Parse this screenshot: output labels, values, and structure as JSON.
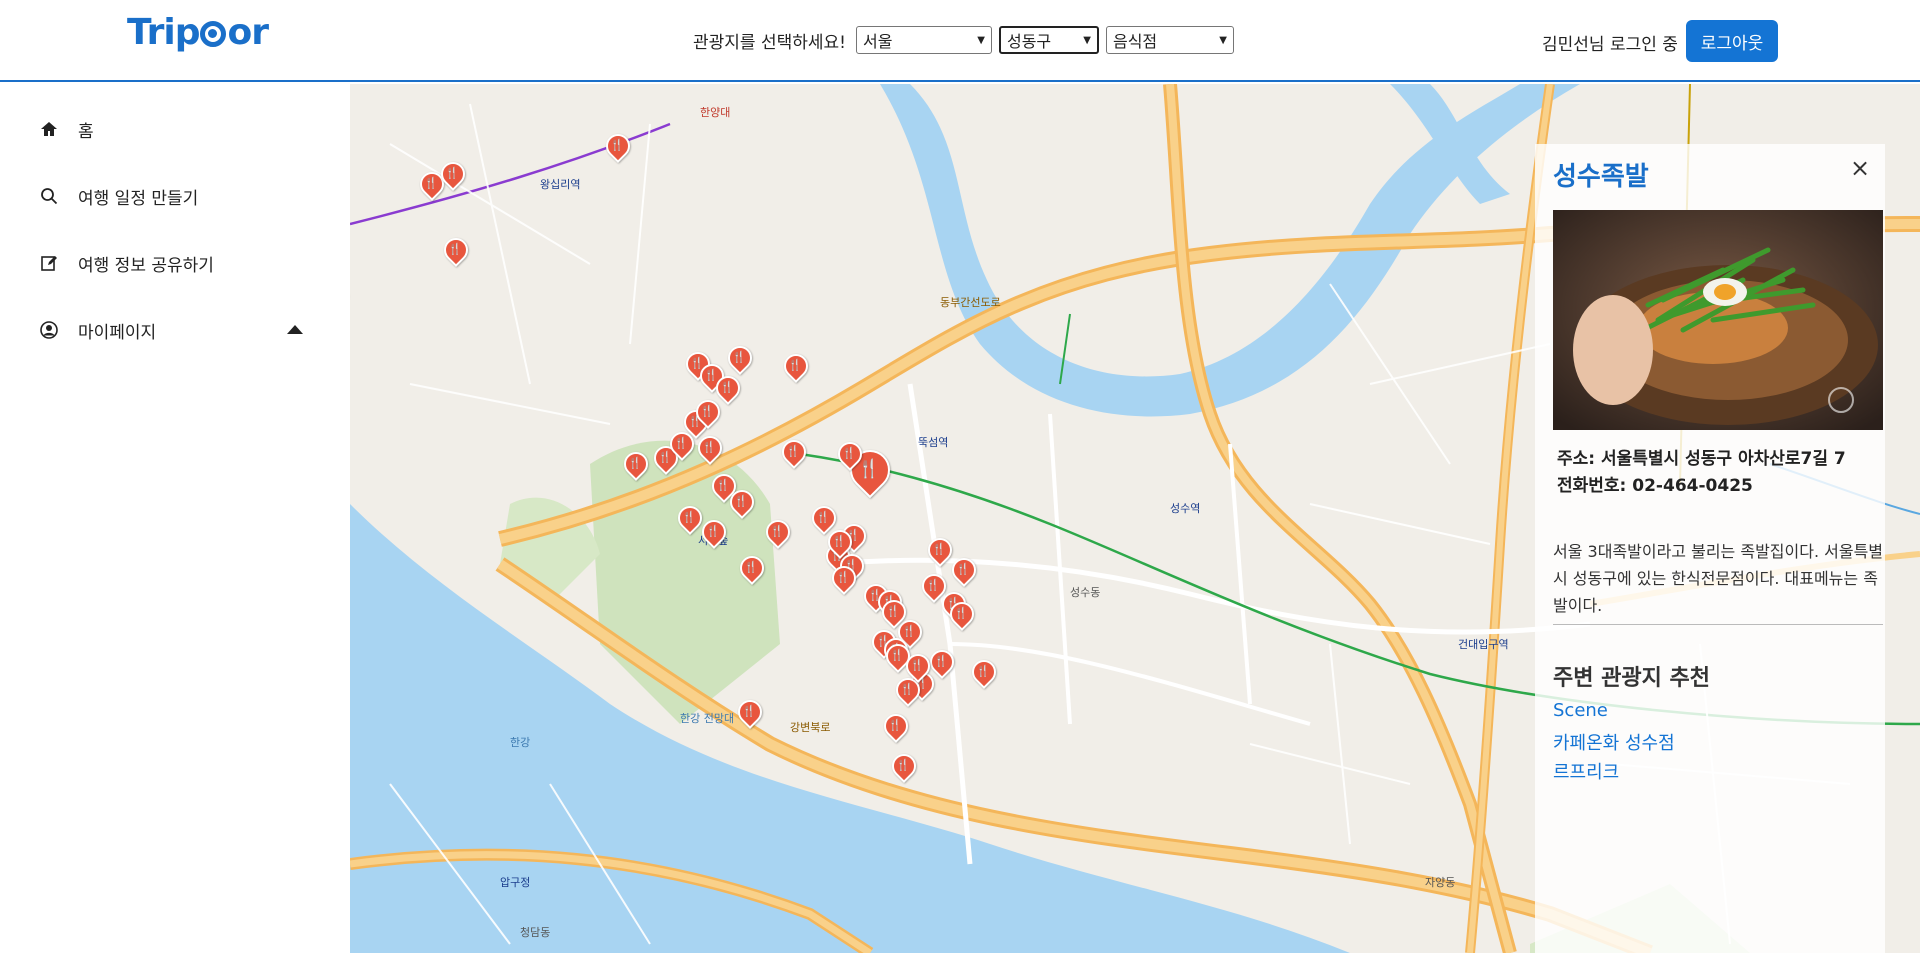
{
  "header": {
    "logo": {
      "part1": "Trip",
      "part2": "or"
    },
    "selector_label": "관광지를 선택하세요!",
    "selects": [
      {
        "value": "서울"
      },
      {
        "value": "성동구"
      },
      {
        "value": "음식점"
      }
    ],
    "login_status": "김민선님 로그인 중",
    "logout_label": "로그아웃"
  },
  "sidebar": {
    "items": [
      {
        "label": "홈",
        "icon": "home-icon"
      },
      {
        "label": "여행 일정 만들기",
        "icon": "search-icon"
      },
      {
        "label": "여행 정보 공유하기",
        "icon": "edit-icon"
      },
      {
        "label": "마이페이지",
        "icon": "user-circle-icon"
      }
    ]
  },
  "map": {
    "labels": {
      "seongsu": "성수역",
      "ttukseom": "뚝섬역",
      "seoulsup": "서울숲",
      "hangang": "한강",
      "gangbyeonbukro": "강변북로",
      "kondae": "건대입구역",
      "wangsimni": "왕십리역",
      "hanyang": "한양대",
      "seongsudong": "성수동",
      "dongbu": "동부간선도로",
      "jayang": "자양동",
      "apgujeong": "압구정",
      "cheongdam": "청담동",
      "ttukseomjeonmang": "한강 전망대"
    }
  },
  "panel": {
    "title": "성수족발",
    "close": "×",
    "address": "주소: 서울특별시 성동구 아차산로7길 7",
    "phone": "전화번호: 02-464-0425",
    "description": "서울 3대족발이라고 불리는 족발집이다. 서울특별시 성동구에 있는 한식전문점이다. 대표메뉴는 족발이다.",
    "recommend_title": "주변 관광지 추천",
    "recommendations": [
      "Scene",
      "카페온화 성수점",
      "르프리크"
    ]
  }
}
